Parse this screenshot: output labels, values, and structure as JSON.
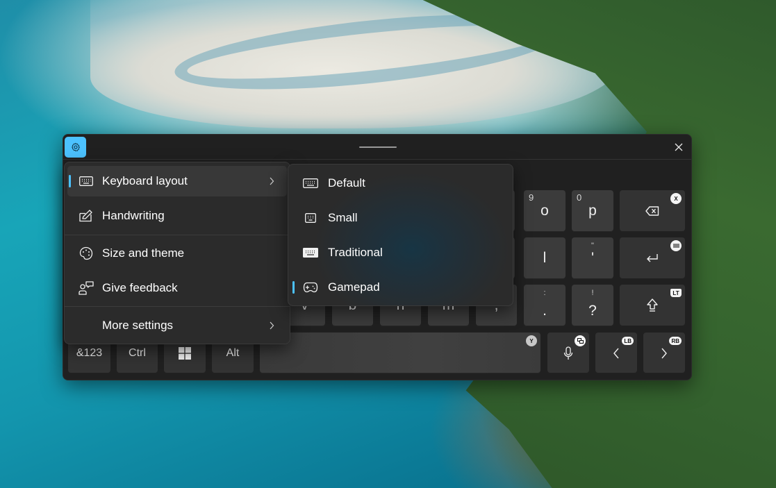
{
  "keyboard": {
    "title_bar": {
      "settings_icon": "gear-icon",
      "close_icon": "close-icon"
    },
    "row1": [
      {
        "secondary": "9",
        "main": "o"
      },
      {
        "secondary": "0",
        "main": "p"
      },
      {
        "icon": "backspace-icon",
        "badge": "X"
      }
    ],
    "row2": [
      {
        "main": "l"
      },
      {
        "secondary": "\"",
        "main": "'"
      },
      {
        "icon": "enter-icon",
        "badge_icon": "menu-icon"
      }
    ],
    "row3_partial": [
      "v",
      "b",
      "n",
      "m",
      ","
    ],
    "row3": [
      {
        "secondary": ":",
        "main": "."
      },
      {
        "secondary": "!",
        "main": "?"
      },
      {
        "icon": "shift-icon",
        "badge": "LT"
      }
    ],
    "row4": {
      "symbols": "&123",
      "ctrl": "Ctrl",
      "windows_icon": "windows-icon",
      "alt": "Alt",
      "space_badge": "Y",
      "mic_icon": "microphone-icon",
      "mic_badge_icon": "view-icon",
      "left_badge": "LB",
      "right_badge": "RB",
      "left_icon": "chevron-left-icon",
      "right_icon": "chevron-right-icon"
    }
  },
  "settings_menu": {
    "items": [
      {
        "label": "Keyboard layout",
        "icon": "keyboard-icon",
        "has_submenu": true,
        "active": true
      },
      {
        "label": "Handwriting",
        "icon": "pen-icon",
        "has_submenu": false
      },
      {
        "label": "Size and theme",
        "icon": "palette-icon",
        "has_submenu": false
      },
      {
        "label": "Give feedback",
        "icon": "feedback-icon",
        "has_submenu": false
      },
      {
        "label": "More settings",
        "icon": "",
        "has_submenu": true
      }
    ]
  },
  "layout_submenu": {
    "items": [
      {
        "label": "Default",
        "icon": "keyboard-icon",
        "selected": false
      },
      {
        "label": "Small",
        "icon": "small-keyboard-icon",
        "selected": false
      },
      {
        "label": "Traditional",
        "icon": "traditional-keyboard-icon",
        "selected": false
      },
      {
        "label": "Gamepad",
        "icon": "gamepad-icon",
        "selected": true
      }
    ]
  },
  "colors": {
    "accent": "#4cc2ff",
    "window_bg": "#202020",
    "menu_bg": "#2b2b2b",
    "key_bg": "#3b3b3b"
  }
}
